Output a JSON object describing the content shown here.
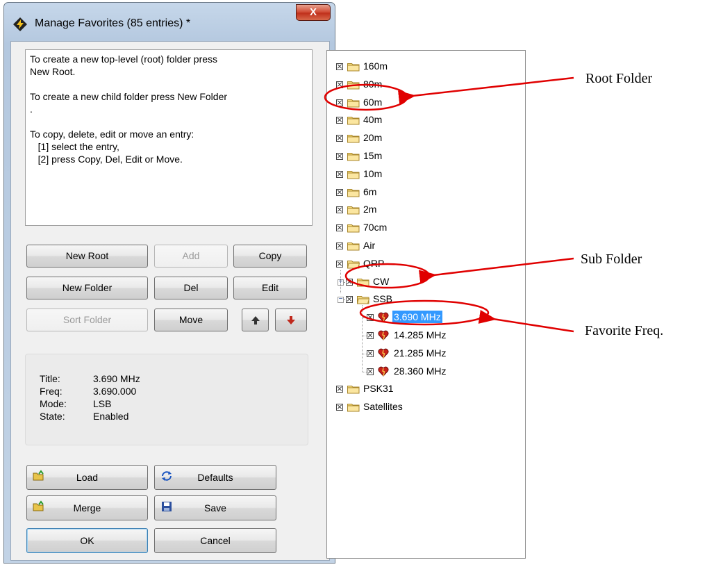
{
  "window": {
    "title": "Manage Favorites (85 entries) *",
    "close_label": "X"
  },
  "help_text": [
    "To create a new top-level (root) folder press",
    "New Root.",
    "",
    "To create a new child folder press New Folder",
    ".",
    "",
    "To copy, delete, edit or move an entry:",
    "   [1] select the entry,",
    "   [2] press Copy, Del, Edit or Move."
  ],
  "buttons": {
    "new_root": "New Root",
    "add": "Add",
    "copy": "Copy",
    "new_folder": "New Folder",
    "del": "Del",
    "edit": "Edit",
    "sort_folder": "Sort Folder",
    "move": "Move",
    "load": "Load",
    "defaults": "Defaults",
    "merge": "Merge",
    "save": "Save",
    "ok": "OK",
    "cancel": "Cancel"
  },
  "details": [
    {
      "key": "Title:",
      "value": "3.690 MHz"
    },
    {
      "key": "Freq:",
      "value": "3.690.000"
    },
    {
      "key": "Mode:",
      "value": "LSB"
    },
    {
      "key": "State:",
      "value": "Enabled"
    }
  ],
  "tree": {
    "root_folders_a": [
      "160m",
      "80m",
      "60m",
      "40m",
      "20m",
      "15m",
      "10m",
      "6m",
      "2m",
      "70cm",
      "Air",
      "QRP"
    ],
    "qrp_children": [
      "CW",
      "SSB"
    ],
    "ssb_children": [
      "3.690 MHz",
      "14.285 MHz",
      "21.285 MHz",
      "28.360 MHz"
    ],
    "selected": "3.690 MHz",
    "root_folders_b": [
      "PSK31",
      "Satellites"
    ]
  },
  "annotations": {
    "root": "Root Folder",
    "sub": "Sub Folder",
    "fav": "Favorite Freq."
  },
  "colors": {
    "selection": "#3399ff",
    "annotation_red": "#e00000"
  }
}
